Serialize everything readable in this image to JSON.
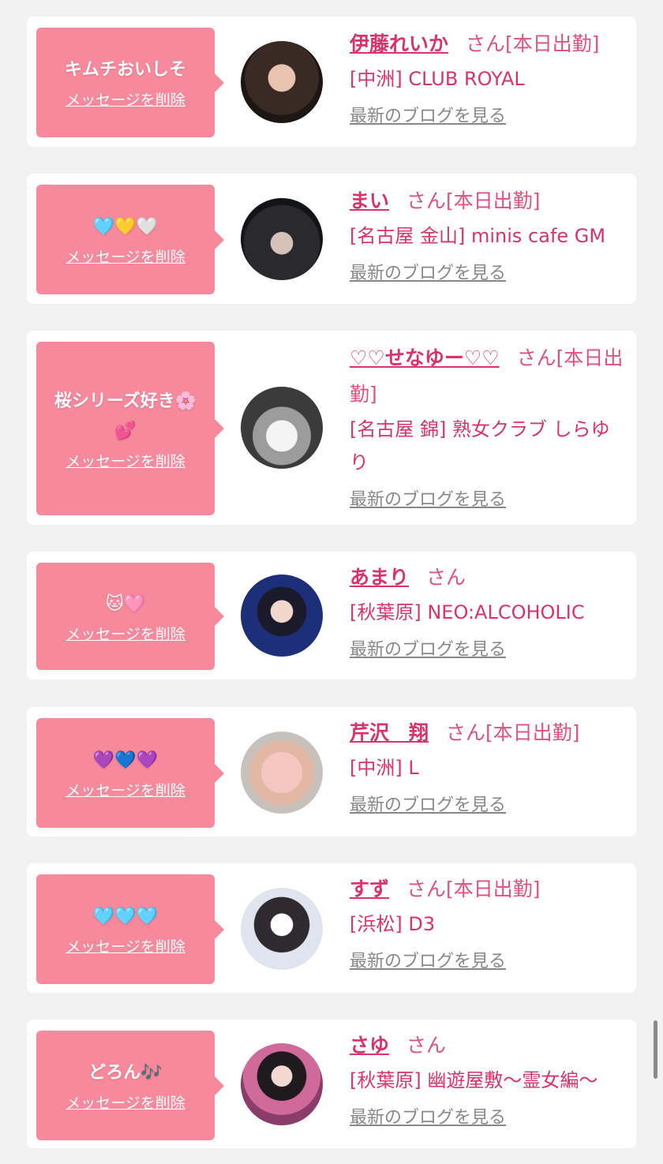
{
  "delete_label": "メッセージを削除",
  "blog_label": "最新のブログを見る",
  "san_label": "さん",
  "items": [
    {
      "message": "キムチおいしそ",
      "name": "伊藤れいか",
      "status": "[本日出勤]",
      "shop": "[中洲] CLUB ROYAL",
      "avatar_icon": "avatar-photo"
    },
    {
      "message": "🩵💛🤍",
      "name": "まい",
      "status": "[本日出勤]",
      "shop": "[名古屋 金山] minis cafe GM",
      "avatar_icon": "avatar-photo"
    },
    {
      "message": "桜シリーズ好き🌸💕",
      "name": "♡♡せなゆー♡♡",
      "status": "[本日出勤]",
      "shop": "[名古屋 錦] 熟女クラブ しらゆり",
      "avatar_icon": "avatar-photo"
    },
    {
      "message": "🐱🩷",
      "name": "あまり",
      "status": "",
      "shop": "[秋葉原] NEO:ALCOHOLIC",
      "avatar_icon": "avatar-photo"
    },
    {
      "message": "💜💙💜",
      "name": "芹沢　翔",
      "status": "[本日出勤]",
      "shop": "[中洲] L",
      "avatar_icon": "avatar-photo"
    },
    {
      "message": "🩵🩵🩵",
      "name": "すず",
      "status": "[本日出勤]",
      "shop": "[浜松] D3",
      "avatar_icon": "avatar-photo"
    },
    {
      "message": "どろん🎶",
      "name": "さゆ",
      "status": "",
      "shop": "[秋葉原] 幽遊屋敷～霊女編～",
      "avatar_icon": "avatar-photo"
    }
  ]
}
